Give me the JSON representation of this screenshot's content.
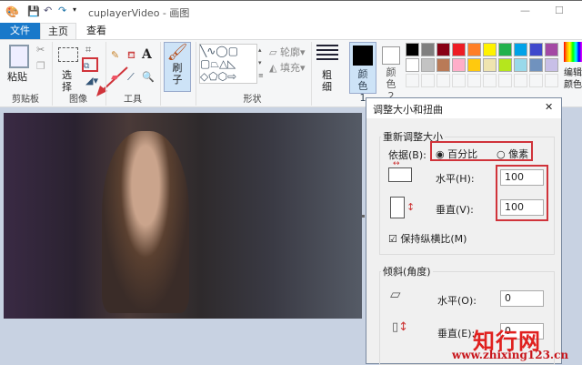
{
  "titlebar": {
    "title": "cuplayerVideo - 画图",
    "minimize": "—",
    "maximize": "☐"
  },
  "tabs": [
    {
      "label": "文件"
    },
    {
      "label": "主页"
    },
    {
      "label": "查看"
    }
  ],
  "ribbon": {
    "clipboard": {
      "paste": "粘贴",
      "group": "剪贴板"
    },
    "image": {
      "select": "选择",
      "group": "图像"
    },
    "tools": {
      "group": "工具"
    },
    "brush": {
      "label": "刷子"
    },
    "shapes": {
      "outline": "轮廓",
      "fill": "填充",
      "group": "形状"
    },
    "size": {
      "label": "粗细"
    },
    "color1": {
      "label": "颜色 1"
    },
    "color2": {
      "label": "颜色 2"
    },
    "edit_colors": {
      "label": "编辑颜色"
    },
    "palette": [
      "#000000",
      "#7f7f7f",
      "#880015",
      "#ed1c24",
      "#ff7f27",
      "#fff200",
      "#22b14c",
      "#00a2e8",
      "#3f48cc",
      "#a349a4",
      "#ffffff",
      "#c3c3c3",
      "#b97a57",
      "#ffaec9",
      "#ffc90e",
      "#efe4b0",
      "#b5e61d",
      "#99d9ea",
      "#7092be",
      "#c8bfe7"
    ]
  },
  "dialog": {
    "title": "调整大小和扭曲",
    "close": "✕",
    "resize": {
      "legend": "重新调整大小",
      "by_label": "依据(B):",
      "percent": "百分比",
      "pixels": "像素",
      "selected": "percent",
      "horizontal_label": "水平(H):",
      "horizontal_value": "100",
      "vertical_label": "垂直(V):",
      "vertical_value": "100",
      "keep_ratio": "保持纵横比(M)",
      "keep_ratio_checked": true
    },
    "skew": {
      "legend": "倾斜(角度)",
      "horizontal_label": "水平(O):",
      "horizontal_value": "0",
      "vertical_label": "垂直(E):",
      "vertical_value": "0"
    }
  },
  "watermark": {
    "name": "知行网",
    "url": "www.zhixing123.cn"
  }
}
